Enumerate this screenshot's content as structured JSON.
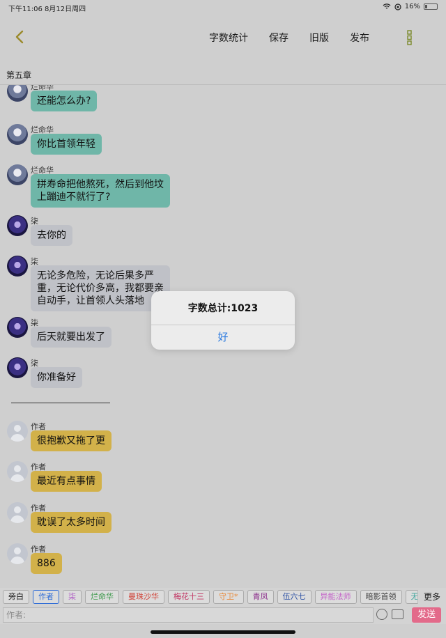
{
  "status_bar": {
    "time_date": "下午11:06  8月12日周四",
    "battery": "16%"
  },
  "toolbar": {
    "word_count": "字数统计",
    "save": "保存",
    "old_version": "旧版",
    "publish": "发布"
  },
  "chapter_title": "第五章",
  "messages": [
    {
      "sender": "烂命华",
      "text": "还能怎么办?"
    },
    {
      "sender": "烂命华",
      "text": "你比首领年轻"
    },
    {
      "sender": "烂命华",
      "lines": [
        "拼寿命把他熬死，然后到他坟",
        "上蹦迪不就行了?"
      ]
    },
    {
      "sender": "柒",
      "text": "去你的"
    },
    {
      "sender": "柒",
      "lines": [
        "无论多危险，无论后果多严",
        "重，无论代价多高，我都要亲",
        "自动手，让首领人头落地"
      ]
    },
    {
      "sender": "柒",
      "text": "后天就要出发了"
    },
    {
      "sender": "柒",
      "text": "你准备好"
    },
    {
      "sender": "作者",
      "text": "很抱歉又拖了更"
    },
    {
      "sender": "作者",
      "text": "最近有点事情"
    },
    {
      "sender": "作者",
      "text": "耽误了太多时间"
    },
    {
      "sender": "作者",
      "text": "886"
    }
  ],
  "roles": [
    "旁白",
    "作者",
    "柒",
    "烂命华",
    "曼珠沙华",
    "梅花十三",
    "守卫*",
    "青凤",
    "伍六七",
    "异能法师",
    "暗影首领",
    "无眼法"
  ],
  "role_colors": [
    "#222222",
    "#2d6bd6",
    "#b05fc5",
    "#3f9a4d",
    "#d0453a",
    "#c23a66",
    "#e88a3a",
    "#8a2b8a",
    "#2a4fa3",
    "#c463c9",
    "#444444",
    "#3aa39a"
  ],
  "more_roles": "更多",
  "input": {
    "placeholder": "作者:",
    "send": "发送"
  },
  "alert": {
    "title": "字数总计:1023",
    "ok": "好"
  }
}
